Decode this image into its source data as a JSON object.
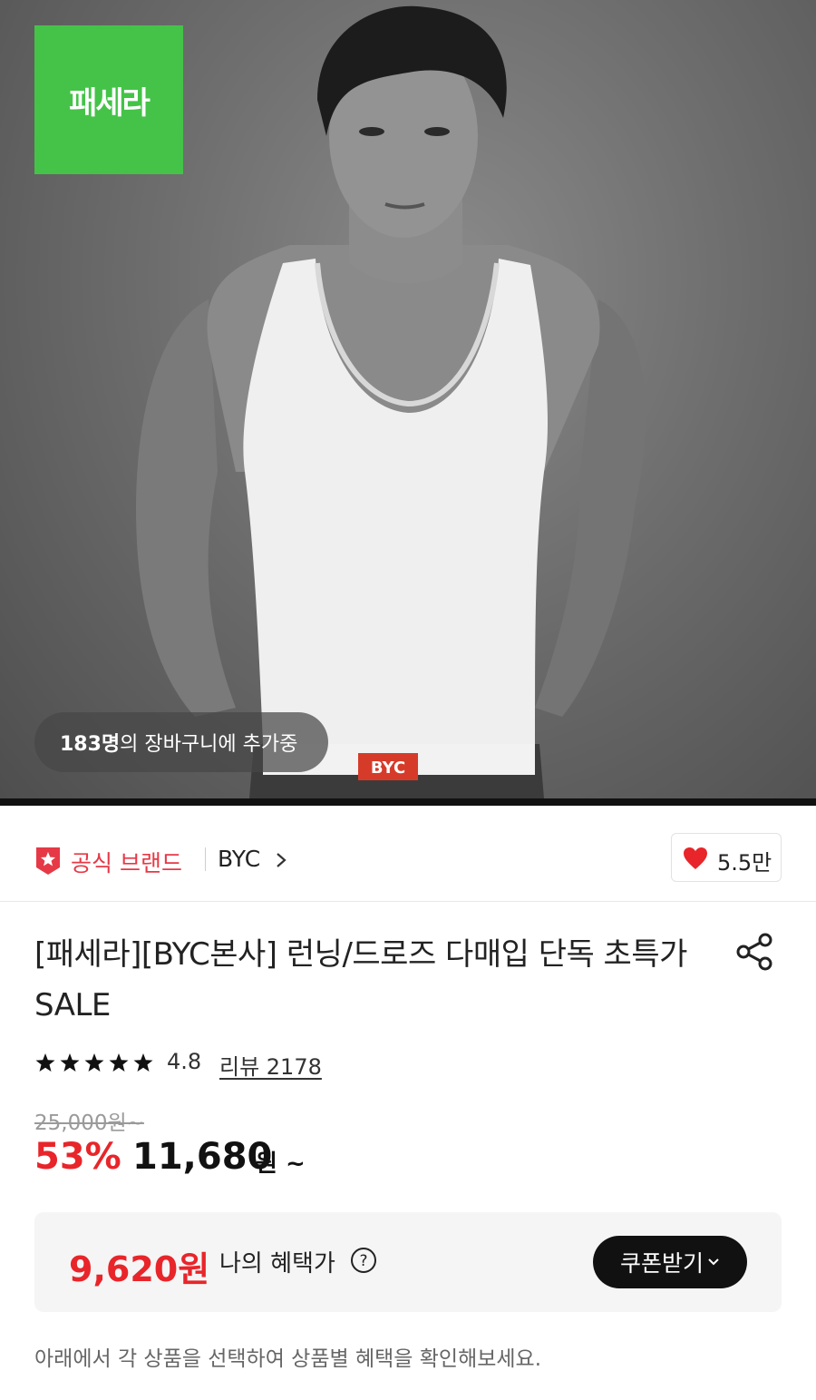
{
  "hero": {
    "store_logo_text": "패세라",
    "cart_count": "183명",
    "cart_text": "의 장바구니에 추가중",
    "waistband_text": "BYC"
  },
  "brand": {
    "official_label": "공식 브랜드",
    "name": "BYC",
    "like_count": "5.5만"
  },
  "product": {
    "title": "[패세라][BYC본사] 런닝/드로즈 다매입 단독 초특가 SALE",
    "rating": "4.8",
    "review_label": "리뷰 2178",
    "rating_stars": 5
  },
  "price": {
    "original": "25,000원~",
    "discount": "53%",
    "sale": "11,680",
    "sale_suffix": "원 ~"
  },
  "benefit": {
    "price": "9,620원",
    "label": "나의 혜택가",
    "coupon_button": "쿠폰받기"
  },
  "notice": "아래에서 각 상품을 선택하여 상품별 혜택을 확인해보세요.",
  "colors": {
    "accent_red": "#e8252a",
    "logo_green": "#44c348"
  }
}
